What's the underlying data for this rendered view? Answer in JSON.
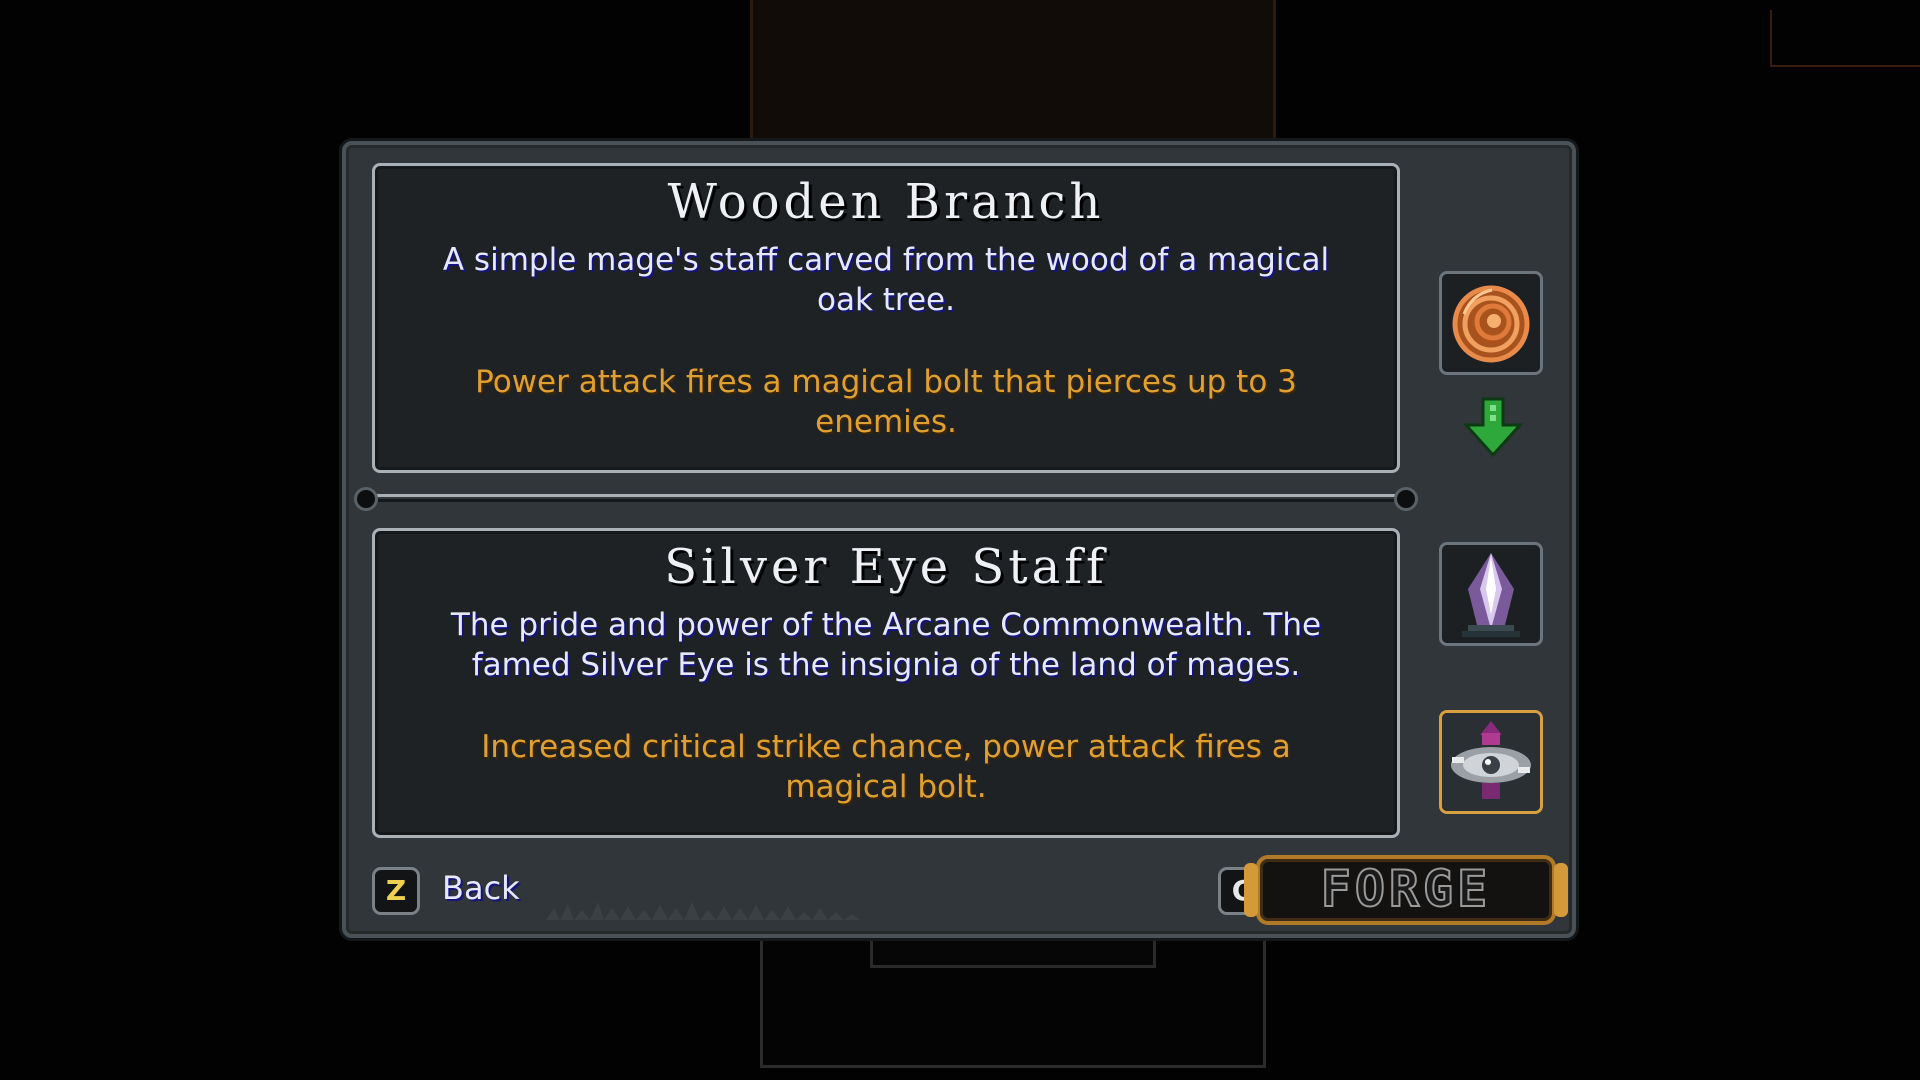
{
  "current_item": {
    "name": "Wooden Branch",
    "description": "A simple mage's staff carved from the wood of a magical oak tree.",
    "effect": "Power attack fires a magical bolt that pierces up to 3 enemies."
  },
  "upgrade_item": {
    "name": "Silver Eye Staff",
    "description": "The pride and power of the Arcane Commonwealth.   The famed Silver Eye is the insignia of the land of mages.",
    "effect": "Increased critical strike chance, power attack fires a magical bolt."
  },
  "controls": {
    "back_key": "Z",
    "back_label": "Back",
    "forge_key": "C",
    "forge_label": "FORGE"
  },
  "icons": {
    "material": "ammonite-shell-icon",
    "gem": "silver-crystal-icon",
    "result": "silver-eye-staff-icon",
    "arrow": "green-down-arrow-icon"
  },
  "colors": {
    "title": "#eef0f5",
    "description": "#e6e8ff",
    "effect": "#e0a030",
    "arrow": "#2ea83a",
    "result_slot_border": "#d8a040"
  }
}
